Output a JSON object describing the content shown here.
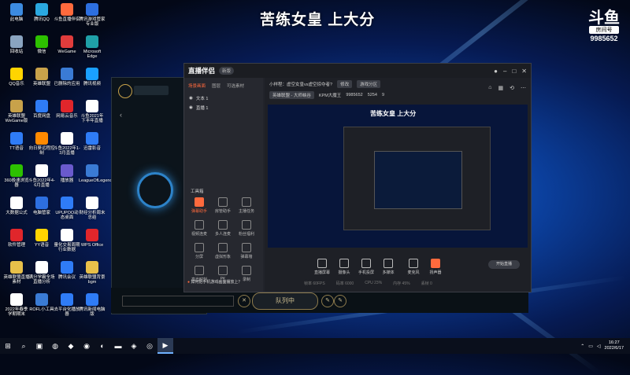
{
  "stream": {
    "title": "苦练女皇 上大分",
    "room_label": "房间号",
    "room_id": "9985652",
    "logo_text": "斗鱼"
  },
  "desktop_icons": [
    {
      "label": "此电脑",
      "icon": "computer-icon",
      "color": "#3c8be0"
    },
    {
      "label": "腾讯QQ",
      "icon": "qq-icon",
      "color": "#2aa8e0"
    },
    {
      "label": "斗鱼直播伴侣",
      "icon": "douyu-icon",
      "color": "#ff6a3d"
    },
    {
      "label": "腾讯游戏管家专业版",
      "icon": "game-manager-icon",
      "color": "#2d6fe0"
    },
    {
      "label": "回收站",
      "icon": "recycle-bin-icon",
      "color": "#8aa4c0"
    },
    {
      "label": "微信",
      "icon": "wechat-icon",
      "color": "#2dc100"
    },
    {
      "label": "WeGame",
      "icon": "wegame-icon",
      "color": "#e03c3c"
    },
    {
      "label": "Microsoft Edge",
      "icon": "edge-icon",
      "color": "#1fa0a8"
    },
    {
      "label": "QQ音乐",
      "icon": "qq-music-icon",
      "color": "#ffd400"
    },
    {
      "label": "英雄联盟",
      "icon": "lol-icon",
      "color": "#c8a24a"
    },
    {
      "label": "已删除的应用",
      "icon": "app-icon",
      "color": "#3a7bd5"
    },
    {
      "label": "腾讯视频",
      "icon": "tencent-video-icon",
      "color": "#1aa0ff"
    },
    {
      "label": "英雄联盟WeGame版",
      "icon": "lol-wegame-icon",
      "color": "#c8a24a"
    },
    {
      "label": "百度网盘",
      "icon": "baidu-pan-icon",
      "color": "#2f7cf6"
    },
    {
      "label": "网易云音乐",
      "icon": "netease-music-icon",
      "color": "#e0262b"
    },
    {
      "label": "斗鱼2021年下半年直播",
      "icon": "doc-icon",
      "color": "#ffffff"
    },
    {
      "label": "TT语音",
      "icon": "tt-icon",
      "color": "#2f7cf6"
    },
    {
      "label": "向日葵远程控制",
      "icon": "sunflower-icon",
      "color": "#ff8a00"
    },
    {
      "label": "斗鱼2022年1-3月直播",
      "icon": "doc-icon",
      "color": "#ffffff"
    },
    {
      "label": "迅雷影音",
      "icon": "xunlei-icon",
      "color": "#2f7cf6"
    },
    {
      "label": "360极速浏览器",
      "icon": "360-icon",
      "color": "#2dc100"
    },
    {
      "label": "斗鱼2022年4-6月直播",
      "icon": "doc-icon",
      "color": "#ffffff"
    },
    {
      "label": "播放器",
      "icon": "player-icon",
      "color": "#6a5acd"
    },
    {
      "label": "LeagueOfLegends",
      "icon": "league-icon",
      "color": "#3a7bd5"
    },
    {
      "label": "大数据公式",
      "icon": "doc-icon",
      "color": "#ffffff"
    },
    {
      "label": "电脑管家",
      "icon": "pc-manager-icon",
      "color": "#2d6fe0"
    },
    {
      "label": "UPUPOO动态桌面",
      "icon": "upupoo-icon",
      "color": "#2f7cf6"
    },
    {
      "label": "财经分析周末总结",
      "icon": "doc-icon",
      "color": "#ffffff"
    },
    {
      "label": "软件管理",
      "icon": "software-icon",
      "color": "#e0262b"
    },
    {
      "label": "YY语音",
      "icon": "yy-icon",
      "color": "#ffd400"
    },
    {
      "label": "量化交易周期行业数据",
      "icon": "doc-icon",
      "color": "#ffffff"
    },
    {
      "label": "WPS Office",
      "icon": "wps-icon",
      "color": "#e0262b"
    },
    {
      "label": "英雄联盟直播素材",
      "icon": "folder-icon",
      "color": "#e8c04a"
    },
    {
      "label": "满分学霸全场直播分析",
      "icon": "doc-icon",
      "color": "#ffffff"
    },
    {
      "label": "腾讯会议",
      "icon": "meeting-icon",
      "color": "#2f7cf6"
    },
    {
      "label": "英雄联盟背景bgm",
      "icon": "folder-icon",
      "color": "#e8c04a"
    },
    {
      "label": "2022年春季学期期末",
      "icon": "doc-icon",
      "color": "#ffffff"
    },
    {
      "label": "ROFL小工具",
      "icon": "rofl-icon",
      "color": "#3a7bd5"
    },
    {
      "label": "去平台化播放器",
      "icon": "player2-icon",
      "color": "#2f7cf6"
    },
    {
      "label": "腾讯新闻电脑版",
      "icon": "news-icon",
      "color": "#2f7cf6"
    }
  ],
  "lol": {
    "queue_label": "队列中"
  },
  "app": {
    "name": "直播伴侣",
    "version": "新版",
    "tabs": [
      "场景画面",
      "图层",
      "可选素材"
    ],
    "scenes": [
      "文本 1",
      "直播 1"
    ],
    "room_title_label": "小样程：虚空女皇vs虚空掠夺者?",
    "edit_chip": "修改",
    "category_chip": "游戏分区",
    "room_name_chip": "英雄联盟 - 大师峡谷",
    "room_meta_1": "KPM大魔王",
    "room_meta_2": "9985652",
    "room_meta_3": "5254",
    "room_meta_4": "9",
    "tools_title": "工具箱",
    "tools": [
      "弹幕助手",
      "房管助手",
      "主播任务",
      "视频连麦",
      "多人连麦",
      "粉丝福利",
      "分屏",
      "虚拟形象",
      "弹幕墙",
      "高光时刻",
      "PK",
      "录制"
    ],
    "notice": "如何把手机游戏画面播放上？",
    "controls": [
      "直播屏幕",
      "摄像头",
      "手机投屏",
      "多媒体",
      "麦克风",
      "扬声器"
    ],
    "start_label": "开始直播",
    "stats": [
      "帧率 60FPS",
      "码率 6000",
      "CPU 23%",
      "内存 45%",
      "丢帧 0"
    ],
    "preview_title": "苦练女皇 上大分"
  },
  "taskbar": {
    "icons": [
      "windows-icon",
      "search-icon",
      "task-view-icon",
      "chrome-icon",
      "douyu-icon",
      "wechat-icon",
      "qq-icon",
      "folder-icon",
      "wegame-icon",
      "edge-icon",
      "live-app-icon"
    ],
    "time": "16:27",
    "date": "2022/6/17"
  }
}
